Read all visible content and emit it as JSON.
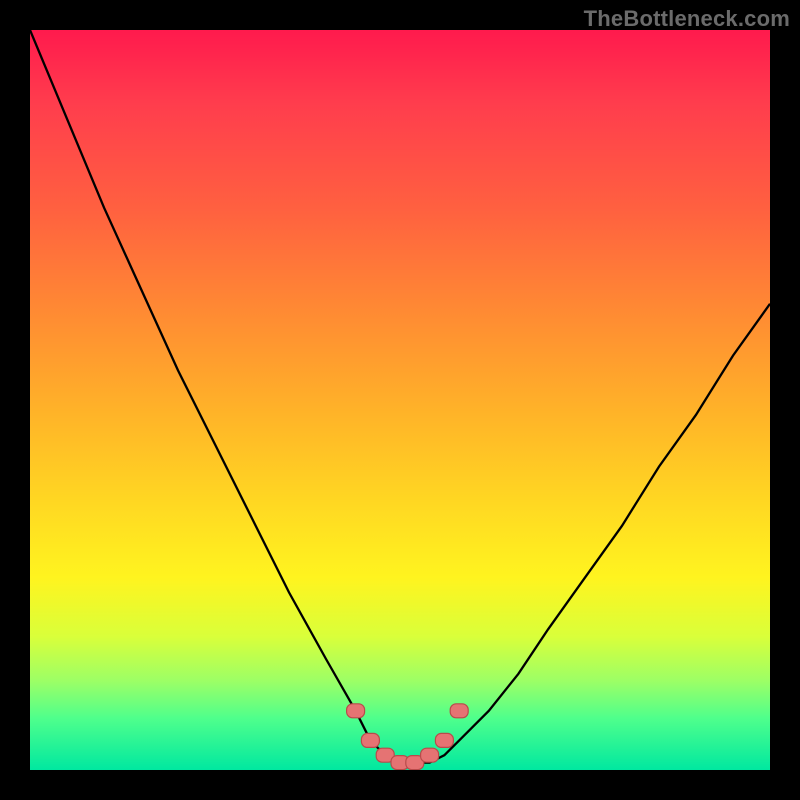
{
  "watermark": "TheBottleneck.com",
  "colors": {
    "black": "#000000",
    "gradient_top": "#ff1a4d",
    "gradient_bottom": "#00e8a0",
    "marker_fill": "#e57373",
    "marker_stroke": "#b84b4b"
  },
  "chart_data": {
    "type": "line",
    "title": "",
    "xlabel": "",
    "ylabel": "",
    "xlim": [
      0,
      100
    ],
    "ylim": [
      0,
      100
    ],
    "legend": false,
    "grid": false,
    "description": "Bottleneck / fit curve. Single black line forming a V with a flat floor; height (y) is the mismatch percentage — lower is better. No axes are rendered. Background is a vertical red→yellow→green heat gradient.",
    "series": [
      {
        "name": "bottleneck_curve",
        "x": [
          0,
          5,
          10,
          15,
          20,
          25,
          30,
          35,
          40,
          44,
          46,
          48,
          50,
          52,
          54,
          56,
          58,
          62,
          66,
          70,
          75,
          80,
          85,
          90,
          95,
          100
        ],
        "y": [
          100,
          88,
          76,
          65,
          54,
          44,
          34,
          24,
          15,
          8,
          4,
          2,
          1,
          1,
          1,
          2,
          4,
          8,
          13,
          19,
          26,
          33,
          41,
          48,
          56,
          63
        ]
      }
    ],
    "markers": {
      "name": "highlighted_points",
      "shape": "rounded-rect",
      "x": [
        44,
        46,
        48,
        50,
        52,
        54,
        56,
        58
      ],
      "y": [
        8,
        4,
        2,
        1,
        1,
        2,
        4,
        8
      ]
    }
  }
}
